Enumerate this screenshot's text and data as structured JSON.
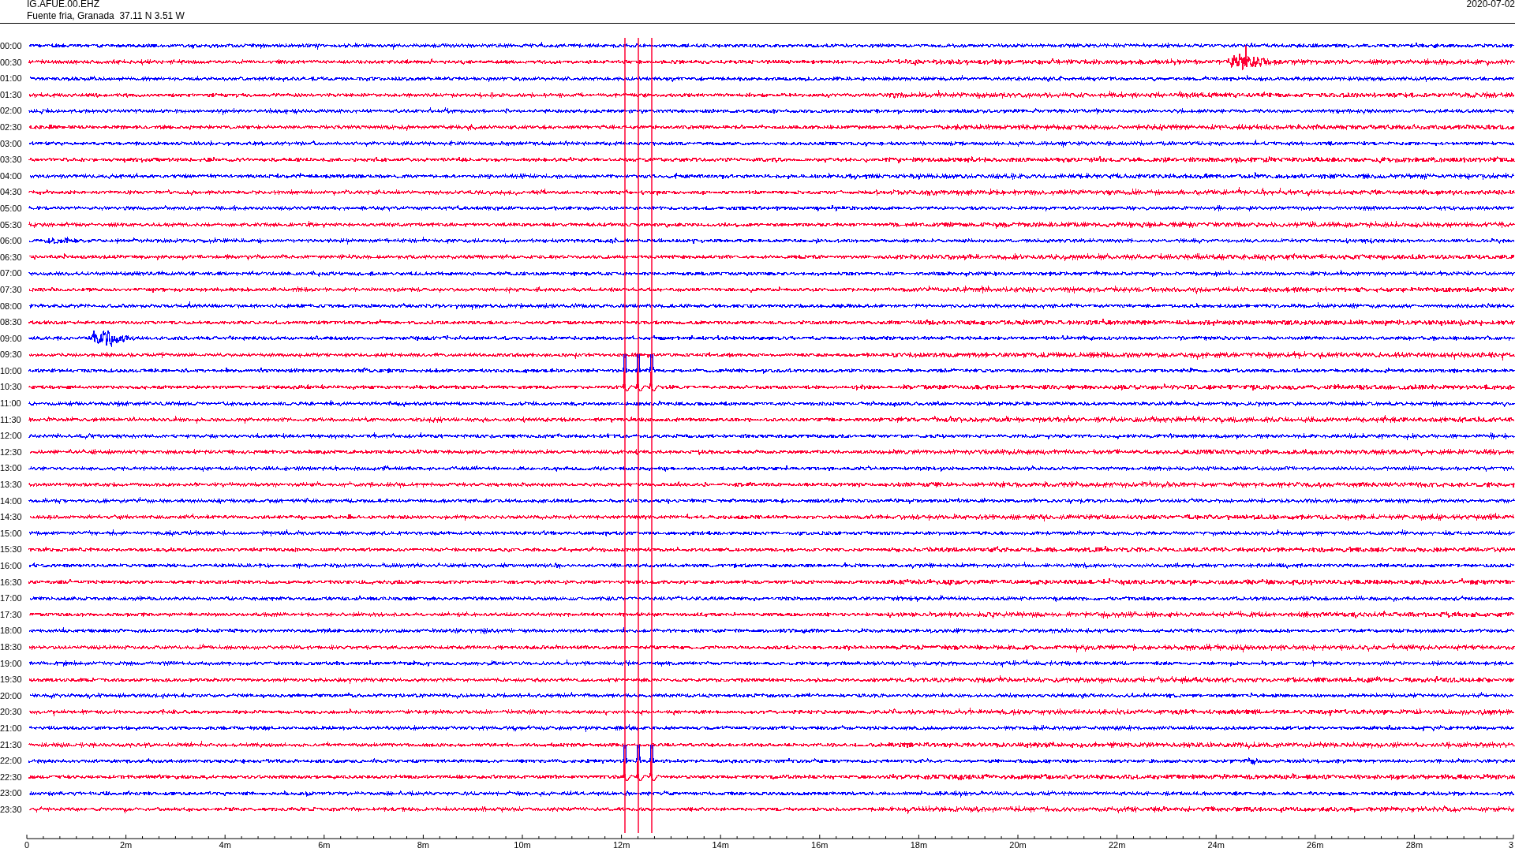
{
  "header": {
    "station": "IG.AFUE.00.EHZ",
    "location": "Fuente fria, Granada  37.11 N 3.51 W",
    "date": "2020-07-02"
  },
  "rows": [
    {
      "time": "00:00",
      "color": "#0000ff"
    },
    {
      "time": "00:30",
      "color": "#ff0033"
    },
    {
      "time": "01:00",
      "color": "#0000ff"
    },
    {
      "time": "01:30",
      "color": "#ff0033"
    },
    {
      "time": "02:00",
      "color": "#0000ff"
    },
    {
      "time": "02:30",
      "color": "#ff0033"
    },
    {
      "time": "03:00",
      "color": "#0000ff"
    },
    {
      "time": "03:30",
      "color": "#ff0033"
    },
    {
      "time": "04:00",
      "color": "#0000ff"
    },
    {
      "time": "04:30",
      "color": "#ff0033"
    },
    {
      "time": "05:00",
      "color": "#0000ff"
    },
    {
      "time": "05:30",
      "color": "#ff0033"
    },
    {
      "time": "06:00",
      "color": "#0000ff"
    },
    {
      "time": "06:30",
      "color": "#ff0033"
    },
    {
      "time": "07:00",
      "color": "#0000ff"
    },
    {
      "time": "07:30",
      "color": "#ff0033"
    },
    {
      "time": "08:00",
      "color": "#0000ff"
    },
    {
      "time": "08:30",
      "color": "#ff0033"
    },
    {
      "time": "09:00",
      "color": "#0000ff"
    },
    {
      "time": "09:30",
      "color": "#ff0033"
    },
    {
      "time": "10:00",
      "color": "#0000ff"
    },
    {
      "time": "10:30",
      "color": "#ff0033"
    },
    {
      "time": "11:00",
      "color": "#0000ff"
    },
    {
      "time": "11:30",
      "color": "#ff0033"
    },
    {
      "time": "12:00",
      "color": "#0000ff"
    },
    {
      "time": "12:30",
      "color": "#ff0033"
    },
    {
      "time": "13:00",
      "color": "#0000ff"
    },
    {
      "time": "13:30",
      "color": "#ff0033"
    },
    {
      "time": "14:00",
      "color": "#0000ff"
    },
    {
      "time": "14:30",
      "color": "#ff0033"
    },
    {
      "time": "15:00",
      "color": "#0000ff"
    },
    {
      "time": "15:30",
      "color": "#ff0033"
    },
    {
      "time": "16:00",
      "color": "#0000ff"
    },
    {
      "time": "16:30",
      "color": "#ff0033"
    },
    {
      "time": "17:00",
      "color": "#0000ff"
    },
    {
      "time": "17:30",
      "color": "#ff0033"
    },
    {
      "time": "18:00",
      "color": "#0000ff"
    },
    {
      "time": "18:30",
      "color": "#ff0033"
    },
    {
      "time": "19:00",
      "color": "#0000ff"
    },
    {
      "time": "19:30",
      "color": "#ff0033"
    },
    {
      "time": "20:00",
      "color": "#0000ff"
    },
    {
      "time": "20:30",
      "color": "#ff0033"
    },
    {
      "time": "21:00",
      "color": "#0000ff"
    },
    {
      "time": "21:30",
      "color": "#ff0033"
    },
    {
      "time": "22:00",
      "color": "#0000ff"
    },
    {
      "time": "22:30",
      "color": "#ff0033"
    },
    {
      "time": "23:00",
      "color": "#0000ff"
    },
    {
      "time": "23:30",
      "color": "#ff0033"
    }
  ],
  "axis": {
    "labels": [
      "0",
      "2m",
      "4m",
      "6m",
      "8m",
      "10m",
      "12m",
      "14m",
      "16m",
      "18m",
      "20m",
      "22m",
      "24m",
      "26m",
      "28m",
      "3"
    ]
  }
}
